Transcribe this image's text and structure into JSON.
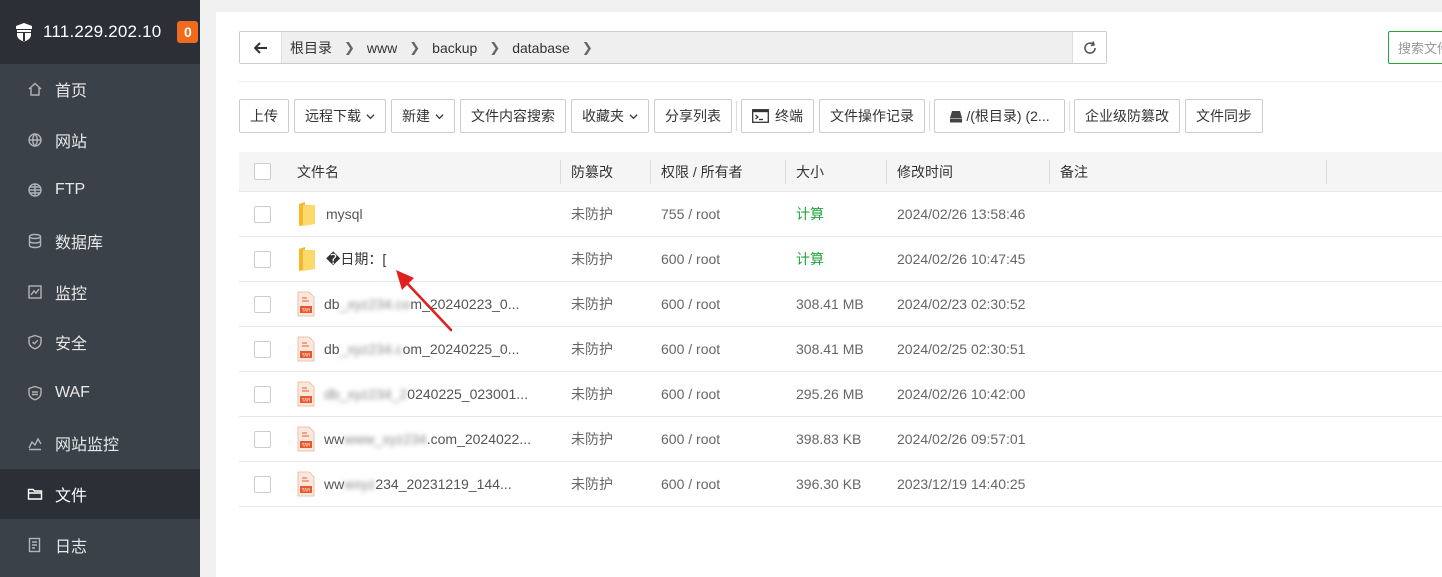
{
  "sidebar": {
    "server_ip": "111.229.202.10",
    "badge_count": "0",
    "items": [
      {
        "label": "首页",
        "icon": "home-icon"
      },
      {
        "label": "网站",
        "icon": "globe-icon"
      },
      {
        "label": "FTP",
        "icon": "globe-icon"
      },
      {
        "label": "数据库",
        "icon": "database-icon"
      },
      {
        "label": "监控",
        "icon": "monitor-icon"
      },
      {
        "label": "安全",
        "icon": "shield-icon"
      },
      {
        "label": "WAF",
        "icon": "waf-shield-icon"
      },
      {
        "label": "网站监控",
        "icon": "chart-icon"
      },
      {
        "label": "文件",
        "icon": "folder-icon",
        "active": true
      },
      {
        "label": "日志",
        "icon": "log-icon"
      }
    ]
  },
  "breadcrumb": {
    "segments": [
      "根目录",
      "www",
      "backup",
      "database"
    ]
  },
  "search": {
    "placeholder": "搜索文件"
  },
  "toolbar": {
    "upload": "上传",
    "remote_download": "远程下载",
    "new": "新建",
    "content_search": "文件内容搜索",
    "favorites": "收藏夹",
    "share_list": "分享列表",
    "terminal": "终端",
    "operation_log": "文件操作记录",
    "disk": "/(根目录) (2...",
    "tamper_proof": "企业级防篡改",
    "file_sync": "文件同步"
  },
  "table": {
    "headers": {
      "name": "文件名",
      "protect": "防篡改",
      "perm": "权限 / 所有者",
      "size": "大小",
      "mtime": "修改时间",
      "note": "备注"
    },
    "rows": [
      {
        "type": "folder",
        "name": "mysql",
        "protect": "未防护",
        "perm": "755 / root",
        "size": "计算",
        "size_is_link": true,
        "mtime": "2024/02/26 13:58:46"
      },
      {
        "type": "folder",
        "name": "�日期：[",
        "protect": "未防护",
        "perm": "600 / root",
        "size": "计算",
        "size_is_link": true,
        "mtime": "2024/02/26 10:47:45"
      },
      {
        "type": "tar",
        "name_prefix": "db",
        "name_blur": "_xyz234.co",
        "name_suffix": "m_20240223_0...",
        "protect": "未防护",
        "perm": "600 / root",
        "size": "308.41 MB",
        "mtime": "2024/02/23 02:30:52"
      },
      {
        "type": "tar",
        "name_prefix": "db",
        "name_blur": "_xyz234.c",
        "name_suffix": "om_20240225_0...",
        "protect": "未防护",
        "perm": "600 / root",
        "size": "308.41 MB",
        "mtime": "2024/02/25 02:30:51"
      },
      {
        "type": "tar",
        "name_prefix": "",
        "name_blur": "db_xyz234_2",
        "name_suffix": "0240225_023001...",
        "protect": "未防护",
        "perm": "600 / root",
        "size": "295.26 MB",
        "mtime": "2024/02/26 10:42:00"
      },
      {
        "type": "tar",
        "name_prefix": "ww",
        "name_blur": "www_xyz234",
        "name_suffix": ".com_2024022...",
        "protect": "未防护",
        "perm": "600 / root",
        "size": "398.83 KB",
        "mtime": "2024/02/26 09:57:01"
      },
      {
        "type": "tar",
        "name_prefix": "ww",
        "name_blur": "wxyz",
        "name_suffix": "234_20231219_144...",
        "protect": "未防护",
        "perm": "600 / root",
        "size": "396.30 KB",
        "mtime": "2023/12/19 14:40:25"
      }
    ]
  },
  "colors": {
    "accent": "#20a53a",
    "sidebar_bg": "#3b4148",
    "badge": "#f06b1c",
    "arrow": "#e02020"
  }
}
